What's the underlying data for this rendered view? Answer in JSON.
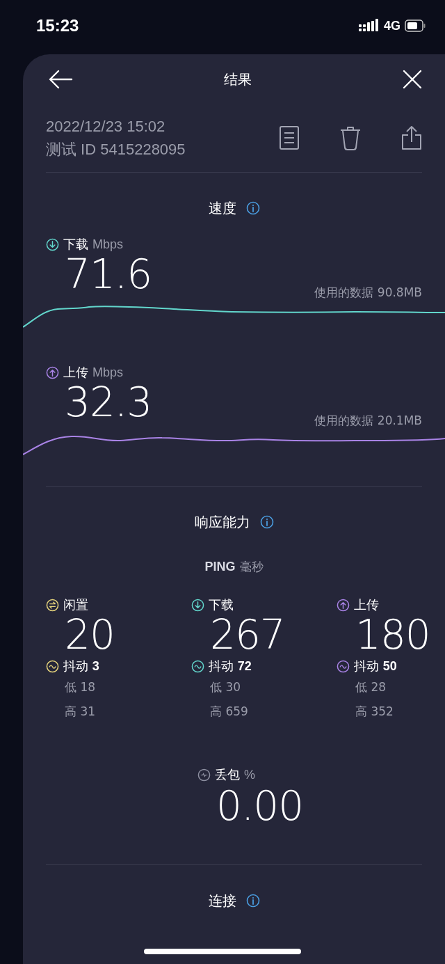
{
  "status_bar": {
    "time": "15:23",
    "network": "4G"
  },
  "header": {
    "title": "结果"
  },
  "test": {
    "date": "2022/12/23 15:02",
    "id": "测试 ID 5415228095"
  },
  "speed": {
    "title": "速度",
    "metrics": [
      {
        "kind": "download",
        "label": "下载",
        "unit": "Mbps",
        "value": "71.6",
        "data_used": "使用的数据 90.8MB"
      },
      {
        "kind": "upload",
        "label": "上传",
        "unit": "Mbps",
        "value": "32.3",
        "data_used": "使用的数据 20.1MB"
      }
    ]
  },
  "responsiveness": {
    "title": "响应能力",
    "ping_label": "PING",
    "ping_unit": "毫秒",
    "columns": [
      {
        "kind": "idle",
        "label": "闲置",
        "value": "20",
        "jitter_label": "抖动",
        "jitter": "3",
        "low_label": "低",
        "low": "18",
        "high_label": "高",
        "high": "31"
      },
      {
        "kind": "download",
        "label": "下载",
        "value": "267",
        "jitter_label": "抖动",
        "jitter": "72",
        "low_label": "低",
        "low": "30",
        "high_label": "高",
        "high": "659"
      },
      {
        "kind": "upload",
        "label": "上传",
        "value": "180",
        "jitter_label": "抖动",
        "jitter": "50",
        "low_label": "低",
        "low": "28",
        "high_label": "高",
        "high": "352"
      }
    ]
  },
  "packet_loss": {
    "label": "丢包",
    "unit": "%",
    "value": "0.00"
  },
  "connection": {
    "title": "连接"
  }
}
